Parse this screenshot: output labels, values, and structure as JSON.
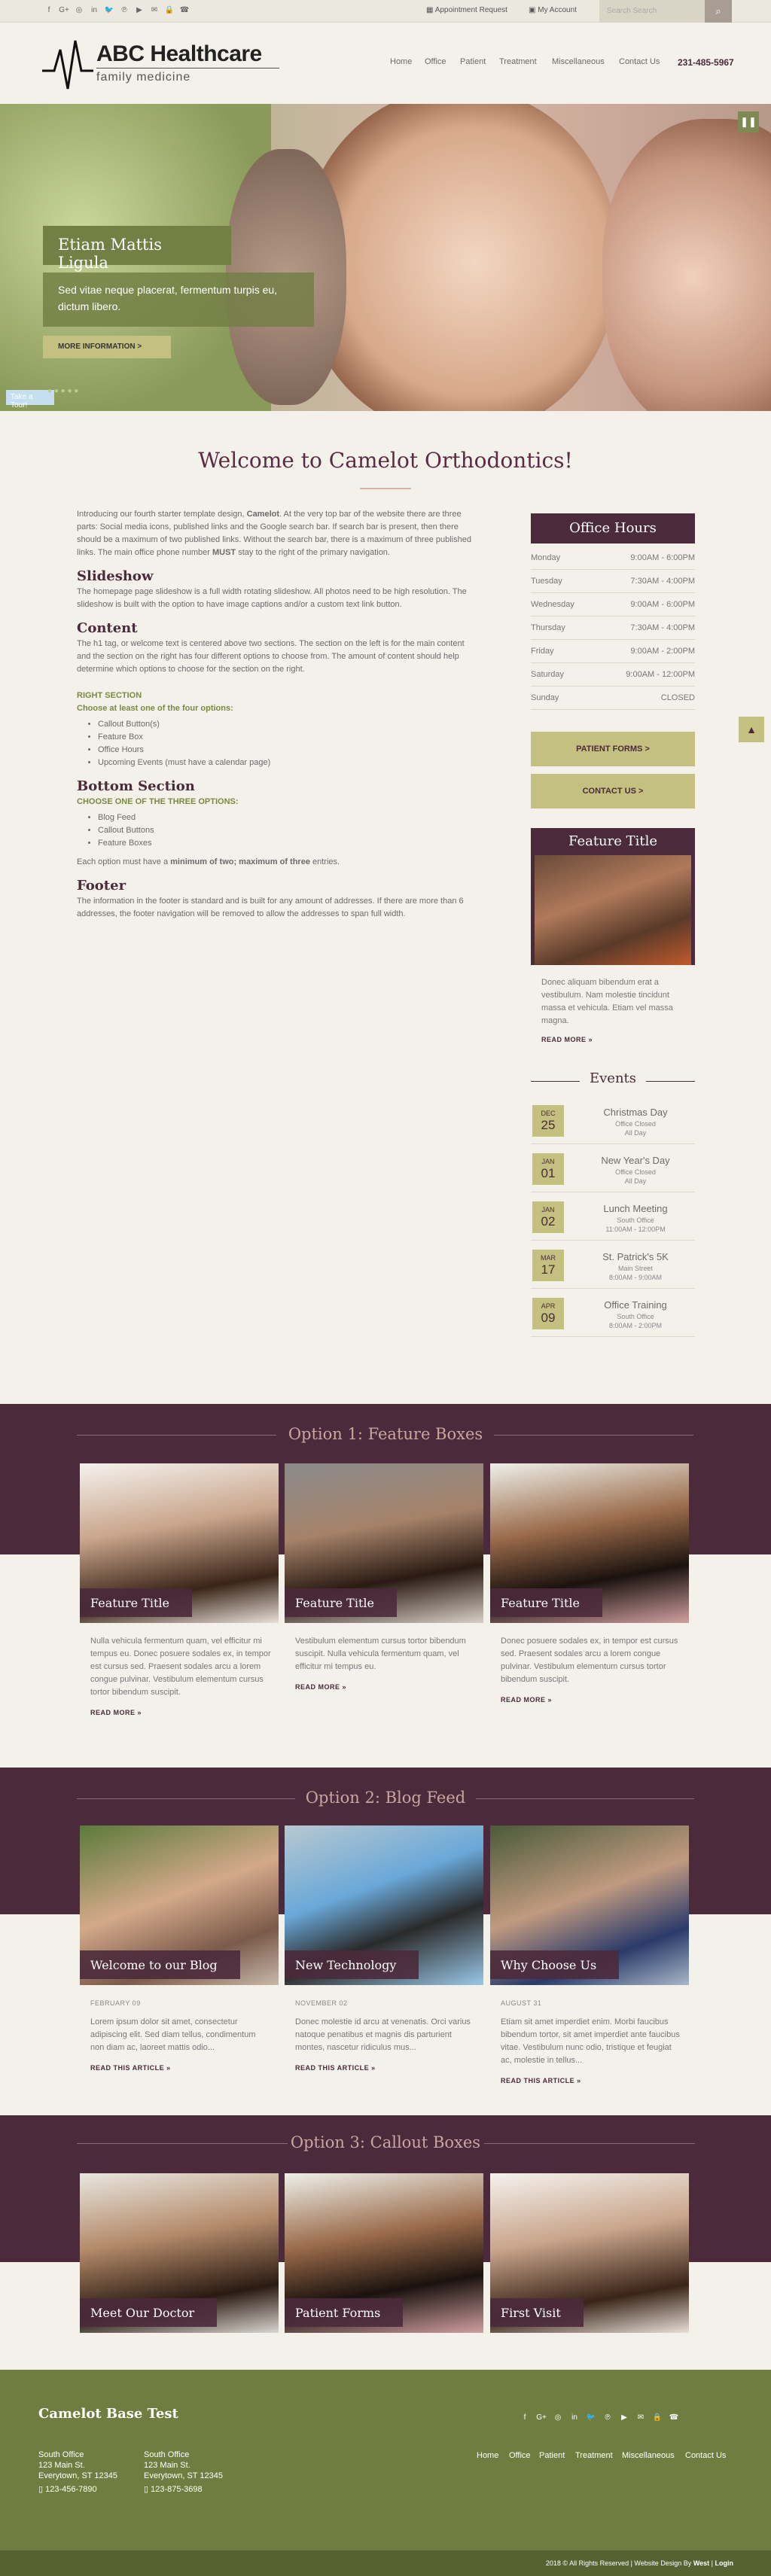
{
  "topbar": {
    "social": [
      "f",
      "G+",
      "◎",
      "in",
      "🐦",
      "℗",
      "▶",
      "✉",
      "🔒",
      "☎"
    ],
    "appointment": "Appointment Request",
    "account": "My Account",
    "search_placeholder": "Search Search",
    "search_icon": "⌕"
  },
  "header": {
    "logo_main": "ABC Healthcare",
    "logo_sub": "family medicine",
    "nav": [
      "Home",
      "Office",
      "Patient",
      "Treatment",
      "Miscellaneous",
      "Contact Us"
    ],
    "phone": "231-485-5967"
  },
  "hero": {
    "title": "Etiam Mattis Ligula",
    "text": "Sed vitae neque placerat, fermentum turpis eu, dictum libero.",
    "button": "MORE INFORMATION  >",
    "pause": "❚❚",
    "take": "Take a Tour!",
    "dots": "● ● ● ● ●"
  },
  "welcome": {
    "title": "Welcome to Camelot Orthodontics!"
  },
  "content": {
    "intro1": "Introducing our fourth starter template design, ",
    "intro_bold": "Camelot",
    "intro2": ". At the very top bar of the website there are three parts: Social media icons, published links and the Google search bar. If search bar is present, then there should be a maximum of two published links. Without the search bar, there is a maximum of three published links. The main office phone number ",
    "intro_must": "MUST",
    "intro3": " stay to the right of the primary navigation.",
    "slideshow_h": "Slideshow",
    "slideshow_p": "The homepage page slideshow is a full width rotating slideshow. All photos need to be high resolution. The slideshow is built with the option to have image captions and/or a custom text link button.",
    "content_h": "Content",
    "content_p": "The h1 tag, or welcome text is centered above two sections. The section on the left is for the main content and the section on the right has four different options to choose from. The amount of content should help determine which options to choose for the section on the right.",
    "right_h": "RIGHT SECTION",
    "right_sub": "Choose at least one of the four options:",
    "right_items": [
      "Callout Button(s)",
      "Feature Box",
      "Office Hours",
      "Upcoming Events (must have a calendar page)"
    ],
    "bottom_h": "Bottom Section",
    "bottom_sub": "CHOOSE ONE OF THE THREE OPTIONS:",
    "bottom_items": [
      "Blog Feed",
      "Callout Buttons",
      "Feature Boxes"
    ],
    "each1": "Each option must have a ",
    "each_bold": "minimum of two; maximum of three",
    "each2": " entries.",
    "footer_h": "Footer",
    "footer_p": "The information in the footer is standard and is built for any amount of addresses. If there are more than 6 addresses, the footer navigation will be removed to allow the addresses to span full width."
  },
  "office_hours": {
    "title": "Office Hours",
    "rows": [
      {
        "day": "Monday",
        "time": "9:00AM - 6:00PM"
      },
      {
        "day": "Tuesday",
        "time": "7:30AM - 4:00PM"
      },
      {
        "day": "Wednesday",
        "time": "9:00AM - 6:00PM"
      },
      {
        "day": "Thursday",
        "time": "7:30AM - 4:00PM"
      },
      {
        "day": "Friday",
        "time": "9:00AM - 2:00PM"
      },
      {
        "day": "Saturday",
        "time": "9:00AM - 12:00PM"
      },
      {
        "day": "Sunday",
        "time": "CLOSED"
      }
    ]
  },
  "side_buttons": [
    "PATIENT FORMS  >",
    "CONTACT US  >"
  ],
  "feature": {
    "title": "Feature Title",
    "text": "Donec aliquam bibendum erat a vestibulum. Nam molestie tincidunt massa et vehicula. Etiam vel massa magna.",
    "read": "READ MORE »"
  },
  "events": {
    "title": "Events",
    "items": [
      {
        "mon": "DEC",
        "day": "25",
        "name": "Christmas Day",
        "l1": "Office Closed",
        "l2": "All Day"
      },
      {
        "mon": "JAN",
        "day": "01",
        "name": "New Year's Day",
        "l1": "Office Closed",
        "l2": "All Day"
      },
      {
        "mon": "JAN",
        "day": "02",
        "name": "Lunch Meeting",
        "l1": "South Office",
        "l2": "11:00AM - 12:00PM"
      },
      {
        "mon": "MAR",
        "day": "17",
        "name": "St. Patrick's 5K",
        "l1": "Main Street",
        "l2": "8:00AM - 9:00AM"
      },
      {
        "mon": "APR",
        "day": "09",
        "name": "Office Training",
        "l1": "South Office",
        "l2": "8:00AM - 2:00PM"
      }
    ]
  },
  "to_top": "▲",
  "opt1": {
    "title": "Option 1: Feature Boxes",
    "cards": [
      {
        "label": "Feature Title",
        "text": "Nulla vehicula fermentum quam, vel efficitur mi tempus eu. Donec posuere sodales ex, in tempor est cursus sed. Praesent sodales arcu a lorem congue pulvinar. Vestibulum elementum cursus tortor bibendum suscipit.",
        "read": "READ MORE »"
      },
      {
        "label": "Feature Title",
        "text": "Vestibulum elementum cursus tortor bibendum suscipit. Nulla vehicula fermentum quam, vel efficitur mi tempus eu.",
        "read": "READ MORE »"
      },
      {
        "label": "Feature Title",
        "text": "Donec posuere sodales ex, in tempor est cursus sed. Praesent sodales arcu a lorem congue pulvinar. Vestibulum elementum cursus tortor bibendum suscipit.",
        "read": "READ MORE »"
      }
    ]
  },
  "opt2": {
    "title": "Option 2: Blog Feed",
    "cards": [
      {
        "label": "Welcome to our Blog",
        "date": "FEBRUARY 09",
        "text": "Lorem ipsum dolor sit amet, consectetur adipiscing elit. Sed diam tellus, condimentum non diam ac, laoreet mattis odio...",
        "read": "READ THIS ARTICLE »"
      },
      {
        "label": "New Technology",
        "date": "NOVEMBER 02",
        "text": "Donec molestie id arcu at venenatis. Orci varius natoque penatibus et magnis dis parturient montes, nascetur ridiculus mus...",
        "read": "READ THIS ARTICLE »"
      },
      {
        "label": "Why Choose Us",
        "date": "AUGUST 31",
        "text": "Etiam sit amet imperdiet enim. Morbi faucibus bibendum tortor, sit amet imperdiet ante faucibus vitae. Vestibulum nunc odio, tristique et feugiat ac, molestie in tellus...",
        "read": "READ THIS ARTICLE »"
      }
    ]
  },
  "opt3": {
    "title": "Option 3: Callout Boxes",
    "cards": [
      {
        "label": "Meet Our Doctor"
      },
      {
        "label": "Patient Forms"
      },
      {
        "label": "First Visit"
      }
    ]
  },
  "footer": {
    "title": "Camelot Base Test",
    "addresses": [
      {
        "name": "South Office",
        "street": "123 Main St.",
        "city": "Everytown, ST 12345",
        "phone": "123-456-7890"
      },
      {
        "name": "South Office",
        "street": "123 Main St.",
        "city": "Everytown, ST 12345",
        "phone": "123-875-3698"
      }
    ],
    "nav": [
      "Home",
      "Office",
      "Patient",
      "Treatment",
      "Miscellaneous",
      "Contact Us"
    ],
    "social": [
      "f",
      "G+",
      "◎",
      "in",
      "🐦",
      "℗",
      "▶",
      "✉",
      "🔒",
      "☎"
    ],
    "copyright": "2018 © All Rights Reserved | Website Design By ",
    "copy_west": "West",
    "copy_login": "Login"
  },
  "colors": {
    "brand": "#4b2a3b",
    "accent_green": "#727f45",
    "button_gold": "#c4c07f",
    "footer": "#6f7e40"
  }
}
